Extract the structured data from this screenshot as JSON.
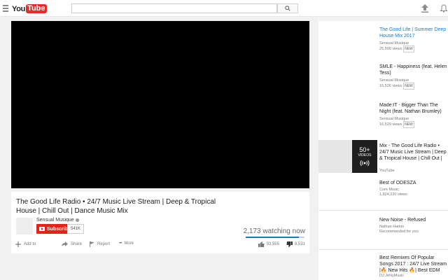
{
  "masthead": {
    "logo_you": "You",
    "logo_tube": "Tube",
    "search_placeholder": ""
  },
  "video": {
    "title": "The Good Life Radio • 24/7 Music Live Stream | Deep & Tropical House | Chill Out | Dance Music Mix",
    "channel": "Sensual Musique",
    "subscribe_label": "Subscribe",
    "subscriber_count": "541K",
    "watching": "2,173 watching now",
    "like_ratio": 0.91,
    "actions": {
      "add_to": "Add to",
      "share": "Share",
      "report": "Report",
      "more": "More"
    },
    "likes": "93,555",
    "dislikes": "8,531"
  },
  "recommendations": [
    {
      "title": "The Good Life | Summer Deep House Mix 2017",
      "channel": "Sensual Musique",
      "views": "25,999 views",
      "badge": "NEW"
    },
    {
      "title": "SMLE - Happiness (feat. Helen Tess)",
      "channel": "Sensual Musique",
      "views": "16,526 views",
      "badge": "NEW"
    },
    {
      "title": "Made:IT - Bigger Than The Night (feat. Nathan Brumley)",
      "channel": "Sensual Musique",
      "views": "16,529 views",
      "badge": "NEW"
    },
    {
      "title": "Mix - The Good Life Radio • 24/7 Music Live Stream | Deep & Tropical House | Chill Out |",
      "channel": "YouTube",
      "playlist_count": "50+",
      "playlist_label": "VIDEOS"
    },
    {
      "title": "Best of ODESZA",
      "channel": "Cure Music",
      "views": "1,824,220 views"
    },
    {
      "title": "New Noise - Refused",
      "channel": "Nathan Harkin",
      "note": "Recommended for you"
    },
    {
      "title": "Best Remixes Of Popular Songs 2017 : 24/7 Live Stream |🔥 New Hits 🔥| Best EDM",
      "channel": "DJ JeNyMusic"
    }
  ]
}
